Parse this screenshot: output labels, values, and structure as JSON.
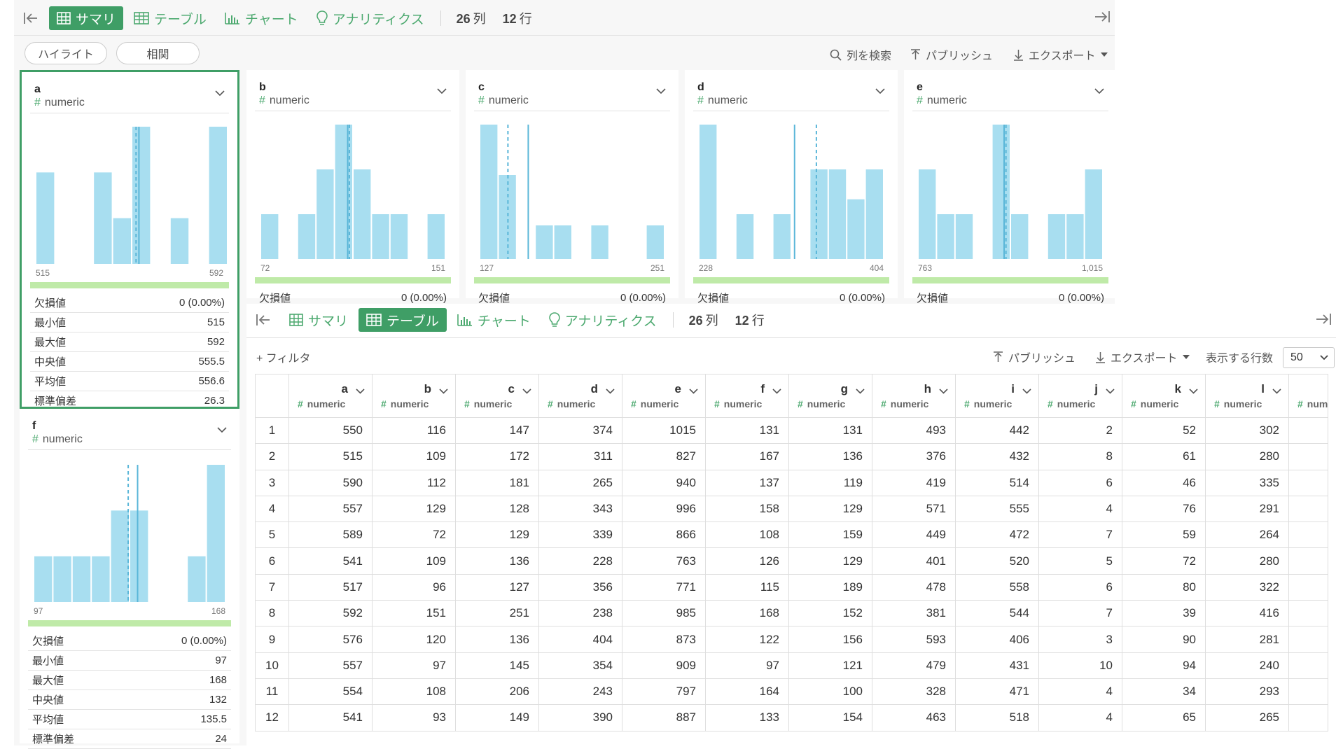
{
  "summary_toolbar": {
    "tabs": [
      {
        "label": "サマリ",
        "icon": "grid-icon"
      },
      {
        "label": "テーブル",
        "icon": "table-icon"
      },
      {
        "label": "チャート",
        "icon": "bar-chart-icon"
      },
      {
        "label": "アナリティクス",
        "icon": "lightbulb-icon"
      }
    ],
    "active_tab": "サマリ",
    "col_count": "26",
    "col_unit": "列",
    "row_count": "12",
    "row_unit": "行"
  },
  "summary_actions": {
    "highlight_label": "ハイライト",
    "correlation_label": "相関",
    "search_columns_label": "列を検索",
    "publish_label": "パブリッシュ",
    "export_label": "エクスポート"
  },
  "column_cards": [
    {
      "name": "a",
      "type": "numeric",
      "min_label": "515",
      "max_label": "592",
      "hist": [
        2,
        0,
        0,
        2,
        1,
        3,
        0,
        1,
        0,
        3
      ],
      "median_frac": 0.523,
      "mean_frac": 0.538,
      "missing_label": "欠損値",
      "missing_value": "0 (0.00%)",
      "stats": [
        {
          "label": "最小値",
          "value": "515"
        },
        {
          "label": "最大値",
          "value": "592"
        },
        {
          "label": "中央値",
          "value": "555.5"
        },
        {
          "label": "平均値",
          "value": "556.6"
        },
        {
          "label": "標準偏差",
          "value": "26.3"
        }
      ]
    },
    {
      "name": "b",
      "type": "numeric",
      "min_label": "72",
      "max_label": "151",
      "hist": [
        1,
        0,
        1,
        2,
        3,
        2,
        1,
        1,
        0,
        1
      ],
      "median_frac": 0.481,
      "mean_frac": 0.472
    },
    {
      "name": "c",
      "type": "numeric",
      "min_label": "127",
      "max_label": "251",
      "hist": [
        4,
        2.5,
        0,
        1,
        1,
        0,
        1,
        0,
        0,
        1
      ],
      "median_frac": 0.153,
      "mean_frac": 0.263
    },
    {
      "name": "d",
      "type": "numeric",
      "min_label": "228",
      "max_label": "404",
      "hist": [
        3,
        0,
        1,
        0,
        1,
        0,
        2,
        2,
        1.333,
        2
      ],
      "median_frac": 0.636,
      "mean_frac": 0.518
    },
    {
      "name": "e",
      "type": "numeric",
      "min_label": "763",
      "max_label": "1,015",
      "hist": [
        2,
        1,
        1,
        0,
        3,
        1,
        0,
        1,
        1,
        2
      ],
      "median_frac": 0.476,
      "mean_frac": 0.466
    },
    {
      "name": "f",
      "type": "numeric",
      "min_label": "97",
      "max_label": "168",
      "hist": [
        1,
        1,
        1,
        1,
        2,
        2,
        0,
        0,
        1,
        3
      ],
      "median_frac": 0.493,
      "mean_frac": 0.542,
      "missing_label": "欠損値",
      "missing_value": "0 (0.00%)",
      "stats": [
        {
          "label": "最小値",
          "value": "97"
        },
        {
          "label": "最大値",
          "value": "168"
        },
        {
          "label": "中央値",
          "value": "132"
        },
        {
          "label": "平均値",
          "value": "135.5"
        },
        {
          "label": "標準偏差",
          "value": "24"
        }
      ]
    }
  ],
  "missing_label": "欠損値",
  "missing_value": "0 (0.00%)",
  "table_toolbar": {
    "tabs": [
      {
        "label": "サマリ",
        "icon": "grid-icon"
      },
      {
        "label": "テーブル",
        "icon": "table-icon"
      },
      {
        "label": "チャート",
        "icon": "bar-chart-icon"
      },
      {
        "label": "アナリティクス",
        "icon": "lightbulb-icon"
      }
    ],
    "active_tab": "テーブル",
    "col_count": "26",
    "col_unit": "列",
    "row_count": "12",
    "row_unit": "行"
  },
  "table_actions": {
    "filter_label": "+ フィルタ",
    "publish_label": "パブリッシュ",
    "export_label": "エクスポート",
    "rows_label": "表示する行数",
    "rows_value": "50"
  },
  "table": {
    "columns": [
      {
        "name": "a",
        "type": "numeric"
      },
      {
        "name": "b",
        "type": "numeric"
      },
      {
        "name": "c",
        "type": "numeric"
      },
      {
        "name": "d",
        "type": "numeric"
      },
      {
        "name": "e",
        "type": "numeric"
      },
      {
        "name": "f",
        "type": "numeric"
      },
      {
        "name": "g",
        "type": "numeric"
      },
      {
        "name": "h",
        "type": "numeric"
      },
      {
        "name": "i",
        "type": "numeric"
      },
      {
        "name": "j",
        "type": "numeric"
      },
      {
        "name": "k",
        "type": "numeric"
      },
      {
        "name": "l",
        "type": "numeric"
      },
      {
        "name": "",
        "type": "num"
      }
    ],
    "rows": [
      {
        "idx": "1",
        "cells": [
          "550",
          "116",
          "147",
          "374",
          "1015",
          "131",
          "131",
          "493",
          "442",
          "2",
          "52",
          "302",
          ""
        ]
      },
      {
        "idx": "2",
        "cells": [
          "515",
          "109",
          "172",
          "311",
          "827",
          "167",
          "136",
          "376",
          "432",
          "8",
          "61",
          "280",
          ""
        ]
      },
      {
        "idx": "3",
        "cells": [
          "590",
          "112",
          "181",
          "265",
          "940",
          "137",
          "119",
          "419",
          "514",
          "6",
          "46",
          "335",
          ""
        ]
      },
      {
        "idx": "4",
        "cells": [
          "557",
          "129",
          "128",
          "343",
          "996",
          "158",
          "129",
          "571",
          "555",
          "4",
          "76",
          "291",
          ""
        ]
      },
      {
        "idx": "5",
        "cells": [
          "589",
          "72",
          "129",
          "339",
          "866",
          "108",
          "159",
          "449",
          "472",
          "7",
          "59",
          "264",
          ""
        ]
      },
      {
        "idx": "6",
        "cells": [
          "541",
          "109",
          "136",
          "228",
          "763",
          "126",
          "129",
          "401",
          "520",
          "5",
          "72",
          "280",
          ""
        ]
      },
      {
        "idx": "7",
        "cells": [
          "517",
          "96",
          "127",
          "356",
          "771",
          "115",
          "189",
          "478",
          "558",
          "6",
          "80",
          "322",
          ""
        ]
      },
      {
        "idx": "8",
        "cells": [
          "592",
          "151",
          "251",
          "238",
          "985",
          "168",
          "152",
          "381",
          "544",
          "7",
          "39",
          "416",
          ""
        ]
      },
      {
        "idx": "9",
        "cells": [
          "576",
          "120",
          "136",
          "404",
          "873",
          "122",
          "156",
          "593",
          "406",
          "3",
          "90",
          "281",
          ""
        ]
      },
      {
        "idx": "10",
        "cells": [
          "557",
          "97",
          "145",
          "354",
          "909",
          "97",
          "121",
          "479",
          "431",
          "10",
          "94",
          "240",
          ""
        ]
      },
      {
        "idx": "11",
        "cells": [
          "554",
          "108",
          "206",
          "243",
          "797",
          "164",
          "100",
          "328",
          "471",
          "4",
          "34",
          "293",
          ""
        ]
      },
      {
        "idx": "12",
        "cells": [
          "541",
          "93",
          "149",
          "390",
          "887",
          "133",
          "154",
          "463",
          "518",
          "4",
          "65",
          "265",
          ""
        ]
      }
    ]
  },
  "colors": {
    "accent": "#3f9e66",
    "accent_text": "#4ca96f",
    "bar": "#a8def0",
    "bar_stroke": "#ffffff",
    "median_line": "#5ab6d8",
    "valid_bar": "#bfeaa8"
  }
}
